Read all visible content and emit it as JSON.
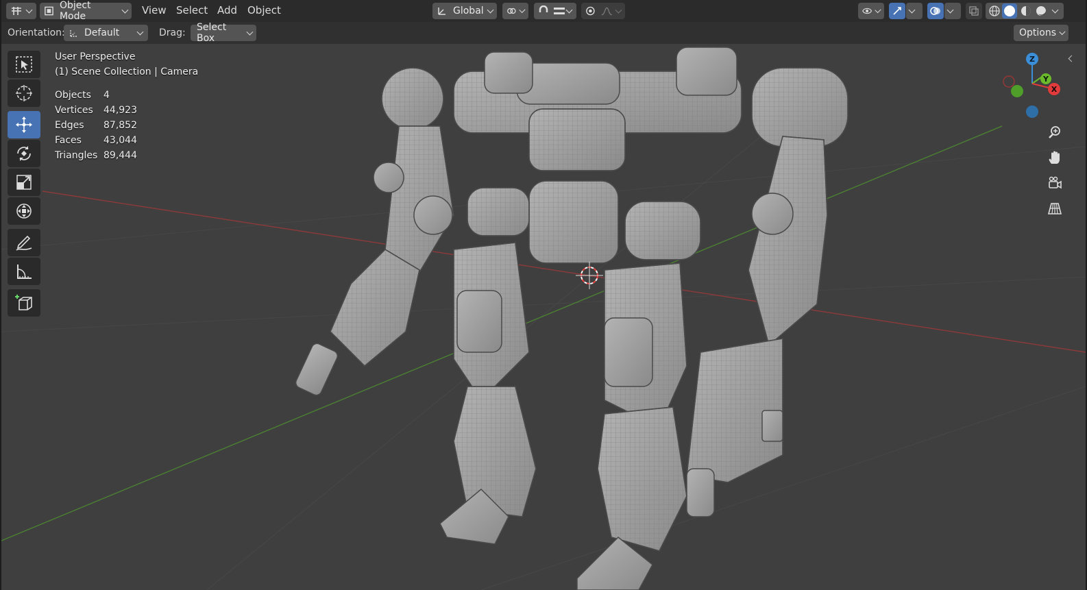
{
  "header": {
    "mode_label": "Object Mode",
    "menu": [
      "View",
      "Select",
      "Add",
      "Object"
    ],
    "transform_orientation": "Global"
  },
  "tool_settings": {
    "orientation_label": "Orientation:",
    "orientation_value": "Default",
    "drag_label": "Drag:",
    "drag_value": "Select Box",
    "options_label": "Options"
  },
  "viewport": {
    "perspective": "User Perspective",
    "collection": "(1) Scene Collection | Camera",
    "stats": [
      {
        "label": "Objects",
        "value": "4"
      },
      {
        "label": "Vertices",
        "value": "44,923"
      },
      {
        "label": "Edges",
        "value": "87,852"
      },
      {
        "label": "Faces",
        "value": "43,044"
      },
      {
        "label": "Triangles",
        "value": "89,444"
      }
    ],
    "gizmo": {
      "x": "X",
      "y": "Y",
      "z": "Z"
    }
  },
  "tools": [
    "select-box-icon",
    "cursor-icon",
    "move-icon",
    "rotate-icon",
    "scale-icon",
    "transform-icon",
    "annotate-icon",
    "measure-icon",
    "add-cube-icon"
  ],
  "colors": {
    "accent": "#4772b3",
    "axis_x": "#e33b3b",
    "axis_y": "#6bba2c",
    "axis_z": "#3b8fd9"
  }
}
